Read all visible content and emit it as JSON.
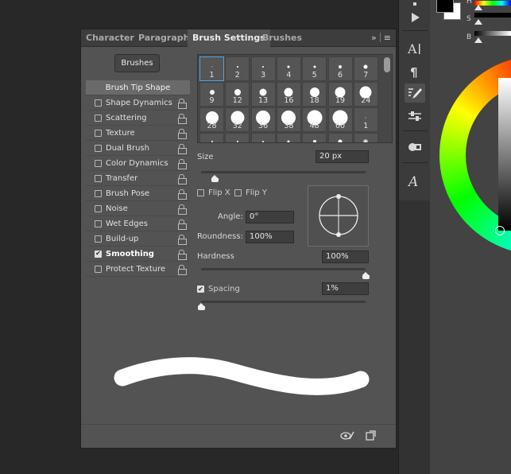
{
  "tabs": [
    {
      "label": "Character"
    },
    {
      "label": "Paragraph"
    },
    {
      "label": "Brush Settings"
    },
    {
      "label": "Brushes"
    }
  ],
  "panel_menu": {
    "collapse_icon": "double-chevron-right-icon",
    "menu_icon": "hamburger-icon"
  },
  "brushes_button": "Brushes",
  "options": [
    {
      "label": "Brush Tip Shape",
      "header": true
    },
    {
      "label": "Shape Dynamics",
      "checked": false
    },
    {
      "label": "Scattering",
      "checked": false
    },
    {
      "label": "Texture",
      "checked": false
    },
    {
      "label": "Dual Brush",
      "checked": false
    },
    {
      "label": "Color Dynamics",
      "checked": false
    },
    {
      "label": "Transfer",
      "checked": false
    },
    {
      "label": "Brush Pose",
      "checked": false
    },
    {
      "label": "Noise",
      "checked": false
    },
    {
      "label": "Wet Edges",
      "checked": false
    },
    {
      "label": "Build-up",
      "checked": false
    },
    {
      "label": "Smoothing",
      "checked": true
    },
    {
      "label": "Protect Texture",
      "checked": false
    }
  ],
  "brush_tips": [
    {
      "label": "1",
      "selected": true
    },
    {
      "label": "2"
    },
    {
      "label": "3"
    },
    {
      "label": "4"
    },
    {
      "label": "5"
    },
    {
      "label": "6"
    },
    {
      "label": "7"
    },
    {
      "label": "9"
    },
    {
      "label": "12"
    },
    {
      "label": "13"
    },
    {
      "label": "16"
    },
    {
      "label": "18"
    },
    {
      "label": "19"
    },
    {
      "label": "24"
    },
    {
      "label": "28"
    },
    {
      "label": "32"
    },
    {
      "label": "36"
    },
    {
      "label": "38"
    },
    {
      "label": "48"
    },
    {
      "label": "60"
    },
    {
      "label": "1"
    },
    {
      "label": ""
    },
    {
      "label": ""
    },
    {
      "label": ""
    },
    {
      "label": ""
    },
    {
      "label": ""
    },
    {
      "label": ""
    },
    {
      "label": ""
    }
  ],
  "size": {
    "label": "Size",
    "value": "20 px",
    "level": 0.08
  },
  "flip_x": {
    "label": "Flip X",
    "checked": false
  },
  "flip_y": {
    "label": "Flip Y",
    "checked": false
  },
  "angle": {
    "label": "Angle:",
    "value": "0°"
  },
  "roundness": {
    "label": "Roundness:",
    "value": "100%"
  },
  "hardness": {
    "label": "Hardness",
    "value": "100%",
    "level": 1.0
  },
  "spacing": {
    "label": "Spacing",
    "value": "1%",
    "checked": true,
    "level": 0.0
  },
  "bottom_icons": [
    "eye-brush-icon",
    "new-preset-icon"
  ],
  "dock": [
    "play-icon",
    "character-icon",
    "paragraph-icon",
    "brush-settings-icon",
    "adjust-icon",
    "cube-icon",
    "glyphs-icon"
  ],
  "color_panel": {
    "labels": [
      "H",
      "S",
      "B"
    ],
    "foreground": "#000000",
    "background": "#ffffff"
  }
}
